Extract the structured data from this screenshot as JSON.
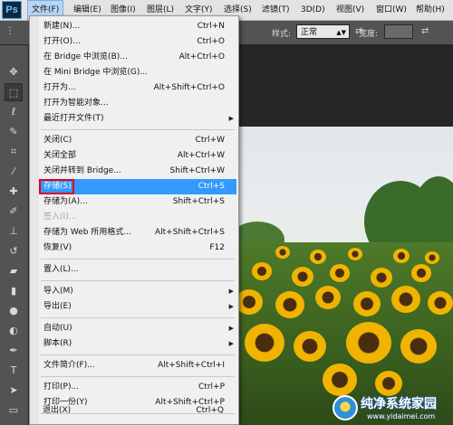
{
  "app": {
    "logo_text": "Ps",
    "menubar": [
      {
        "label": "文件(F)"
      },
      {
        "label": "编辑(E)"
      },
      {
        "label": "图像(I)"
      },
      {
        "label": "图层(L)"
      },
      {
        "label": "文字(Y)"
      },
      {
        "label": "选择(S)"
      },
      {
        "label": "滤镜(T)"
      },
      {
        "label": "3D(D)"
      },
      {
        "label": "视图(V)"
      },
      {
        "label": "窗口(W)"
      },
      {
        "label": "帮助(H)"
      }
    ]
  },
  "options_bar": {
    "style_label": "样式:",
    "style_value": "正常",
    "width_label": "宽度:"
  },
  "file_menu": {
    "items": [
      {
        "label": "新建(N)...",
        "shortcut": "Ctrl+N"
      },
      {
        "label": "打开(O)...",
        "shortcut": "Ctrl+O"
      },
      {
        "label": "在 Bridge 中浏览(B)...",
        "shortcut": "Alt+Ctrl+O"
      },
      {
        "label": "在 Mini Bridge 中浏览(G)...",
        "shortcut": ""
      },
      {
        "label": "打开为...",
        "shortcut": "Alt+Shift+Ctrl+O"
      },
      {
        "label": "打开为智能对象...",
        "shortcut": ""
      },
      {
        "label": "最近打开文件(T)",
        "shortcut": ""
      },
      {
        "label": "关闭(C)",
        "shortcut": "Ctrl+W"
      },
      {
        "label": "关闭全部",
        "shortcut": "Alt+Ctrl+W"
      },
      {
        "label": "关闭并转到 Bridge...",
        "shortcut": "Shift+Ctrl+W"
      },
      {
        "label": "存储(S)",
        "shortcut": "Ctrl+S"
      },
      {
        "label": "存储为(A)...",
        "shortcut": "Shift+Ctrl+S"
      },
      {
        "label": "签入(I)...",
        "shortcut": ""
      },
      {
        "label": "存储为 Web 所用格式...",
        "shortcut": "Alt+Shift+Ctrl+S"
      },
      {
        "label": "恢复(V)",
        "shortcut": "F12"
      },
      {
        "label": "置入(L)...",
        "shortcut": ""
      },
      {
        "label": "导入(M)",
        "shortcut": ""
      },
      {
        "label": "导出(E)",
        "shortcut": ""
      },
      {
        "label": "自动(U)",
        "shortcut": ""
      },
      {
        "label": "脚本(R)",
        "shortcut": ""
      },
      {
        "label": "文件简介(F)...",
        "shortcut": "Alt+Shift+Ctrl+I"
      },
      {
        "label": "打印(P)...",
        "shortcut": "Ctrl+P"
      },
      {
        "label": "打印一份(Y)",
        "shortcut": "Alt+Shift+Ctrl+P"
      },
      {
        "label": "退出(X)",
        "shortcut": "Ctrl+Q"
      }
    ]
  },
  "watermark": {
    "title": "纯净系统家园",
    "url": "www.yidaimei.com"
  },
  "colors": {
    "highlight": "#3399ff",
    "annotation_box": "#e0001a",
    "panel_bg": "#535353"
  }
}
